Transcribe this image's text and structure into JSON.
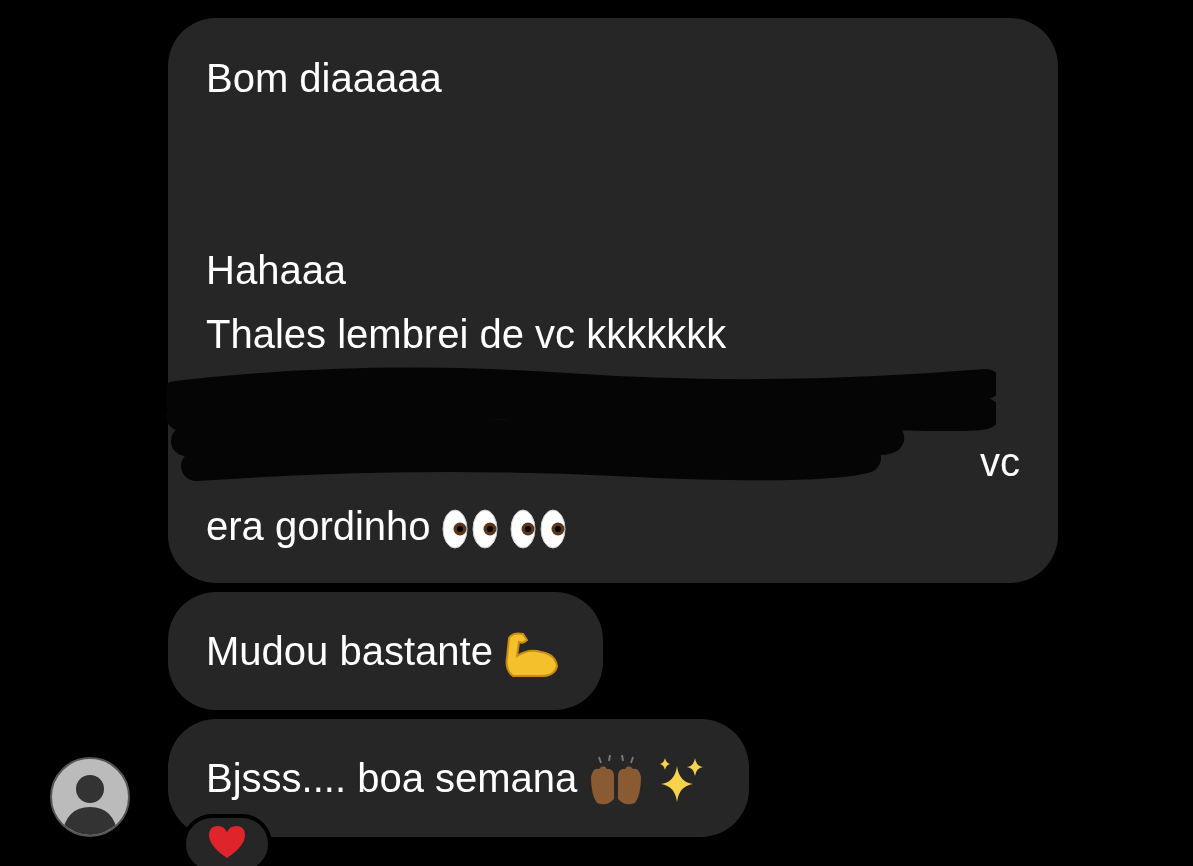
{
  "messages": [
    {
      "parts": [
        {
          "kind": "text",
          "text": "Bom diaaaaa"
        },
        {
          "kind": "spacer"
        },
        {
          "kind": "text",
          "text": "Hahaaa"
        },
        {
          "kind": "text",
          "text": "Thales lembrei de vc kkkkkkk"
        },
        {
          "kind": "redacted",
          "text": "vc"
        },
        {
          "kind": "text",
          "text": "era gordinho",
          "icons": [
            {
              "kind": "eyes"
            },
            {
              "kind": "eyes"
            }
          ]
        }
      ],
      "avatar": false
    },
    {
      "parts": [
        {
          "kind": "text",
          "text": "Mudou bastante",
          "icons": [
            {
              "kind": "arm"
            }
          ]
        }
      ],
      "avatar": false
    },
    {
      "parts": [
        {
          "kind": "text",
          "text": "Bjsss.... boa semana",
          "icons": [
            {
              "kind": "hands"
            },
            {
              "kind": "sparkles"
            }
          ]
        }
      ],
      "avatar": true,
      "reaction": {
        "kind": "heart"
      }
    }
  ]
}
